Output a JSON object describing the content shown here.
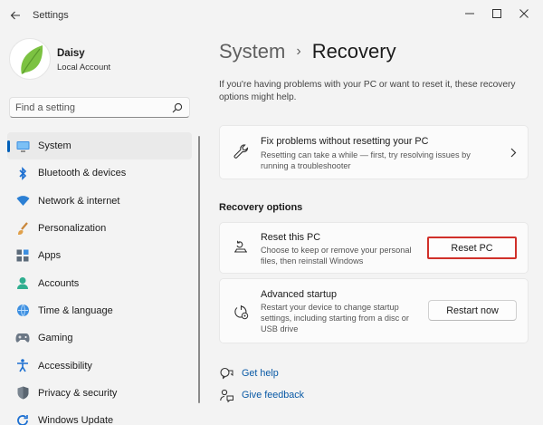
{
  "window": {
    "title": "Settings"
  },
  "profile": {
    "name": "Daisy",
    "account_type": "Local Account"
  },
  "search": {
    "placeholder": "Find a setting"
  },
  "nav": {
    "items": [
      {
        "label": "System",
        "icon": "monitor-icon"
      },
      {
        "label": "Bluetooth & devices",
        "icon": "bluetooth-icon"
      },
      {
        "label": "Network & internet",
        "icon": "wifi-icon"
      },
      {
        "label": "Personalization",
        "icon": "brush-icon"
      },
      {
        "label": "Apps",
        "icon": "apps-icon"
      },
      {
        "label": "Accounts",
        "icon": "person-icon"
      },
      {
        "label": "Time & language",
        "icon": "globe-icon"
      },
      {
        "label": "Gaming",
        "icon": "gamepad-icon"
      },
      {
        "label": "Accessibility",
        "icon": "accessibility-icon"
      },
      {
        "label": "Privacy & security",
        "icon": "shield-icon"
      },
      {
        "label": "Windows Update",
        "icon": "update-icon"
      }
    ]
  },
  "breadcrumb": {
    "parent": "System",
    "separator": "›",
    "current": "Recovery"
  },
  "intro": "If you're having problems with your PC or want to reset it, these recovery options might help.",
  "fix_card": {
    "title": "Fix problems without resetting your PC",
    "description": "Resetting can take a while — first, try resolving issues by running a troubleshooter"
  },
  "recovery": {
    "section_title": "Recovery options",
    "reset": {
      "title": "Reset this PC",
      "description": "Choose to keep or remove your personal files, then reinstall Windows",
      "button": "Reset PC"
    },
    "advanced": {
      "title": "Advanced startup",
      "description": "Restart your device to change startup settings, including starting from a disc or USB drive",
      "button": "Restart now"
    }
  },
  "links": {
    "help": "Get help",
    "feedback": "Give feedback"
  },
  "colors": {
    "accent": "#005fb8",
    "highlight_border": "#d0302a",
    "link": "#0a5aa6"
  }
}
